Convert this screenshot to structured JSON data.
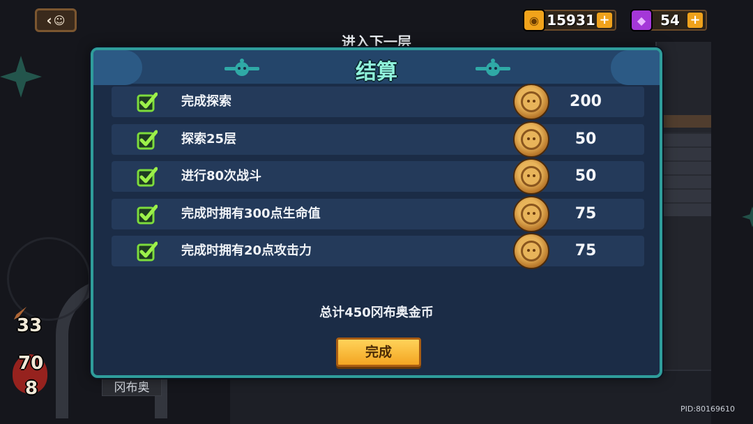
{
  "top_bar": {
    "back_icon": "back-arrow-icon",
    "gold": {
      "icon": "gold-coin-icon",
      "value": "15931",
      "plus": "+"
    },
    "gem": {
      "icon": "purple-gem-icon",
      "value": "54",
      "plus": "+"
    },
    "next_floor_label": "进入下一层"
  },
  "hud": {
    "attack": "33",
    "hp": "70",
    "level": "8",
    "character_name": "冈布奥"
  },
  "modal": {
    "title": "结算",
    "rows": [
      {
        "label": "完成探索",
        "value": "200"
      },
      {
        "label": "探索25层",
        "value": "50"
      },
      {
        "label": "进行80次战斗",
        "value": "50"
      },
      {
        "label": "完成时拥有300点生命值",
        "value": "75"
      },
      {
        "label": "完成时拥有20点攻击力",
        "value": "75"
      }
    ],
    "total": "总计450冈布奥金币",
    "done_button": "完成"
  },
  "pid": "PID:80169610",
  "colors": {
    "modal_border": "#2f9d9b",
    "title_green": "#8ff2da",
    "button_orange": "#f3a522",
    "check_green": "#7ddc3c"
  }
}
